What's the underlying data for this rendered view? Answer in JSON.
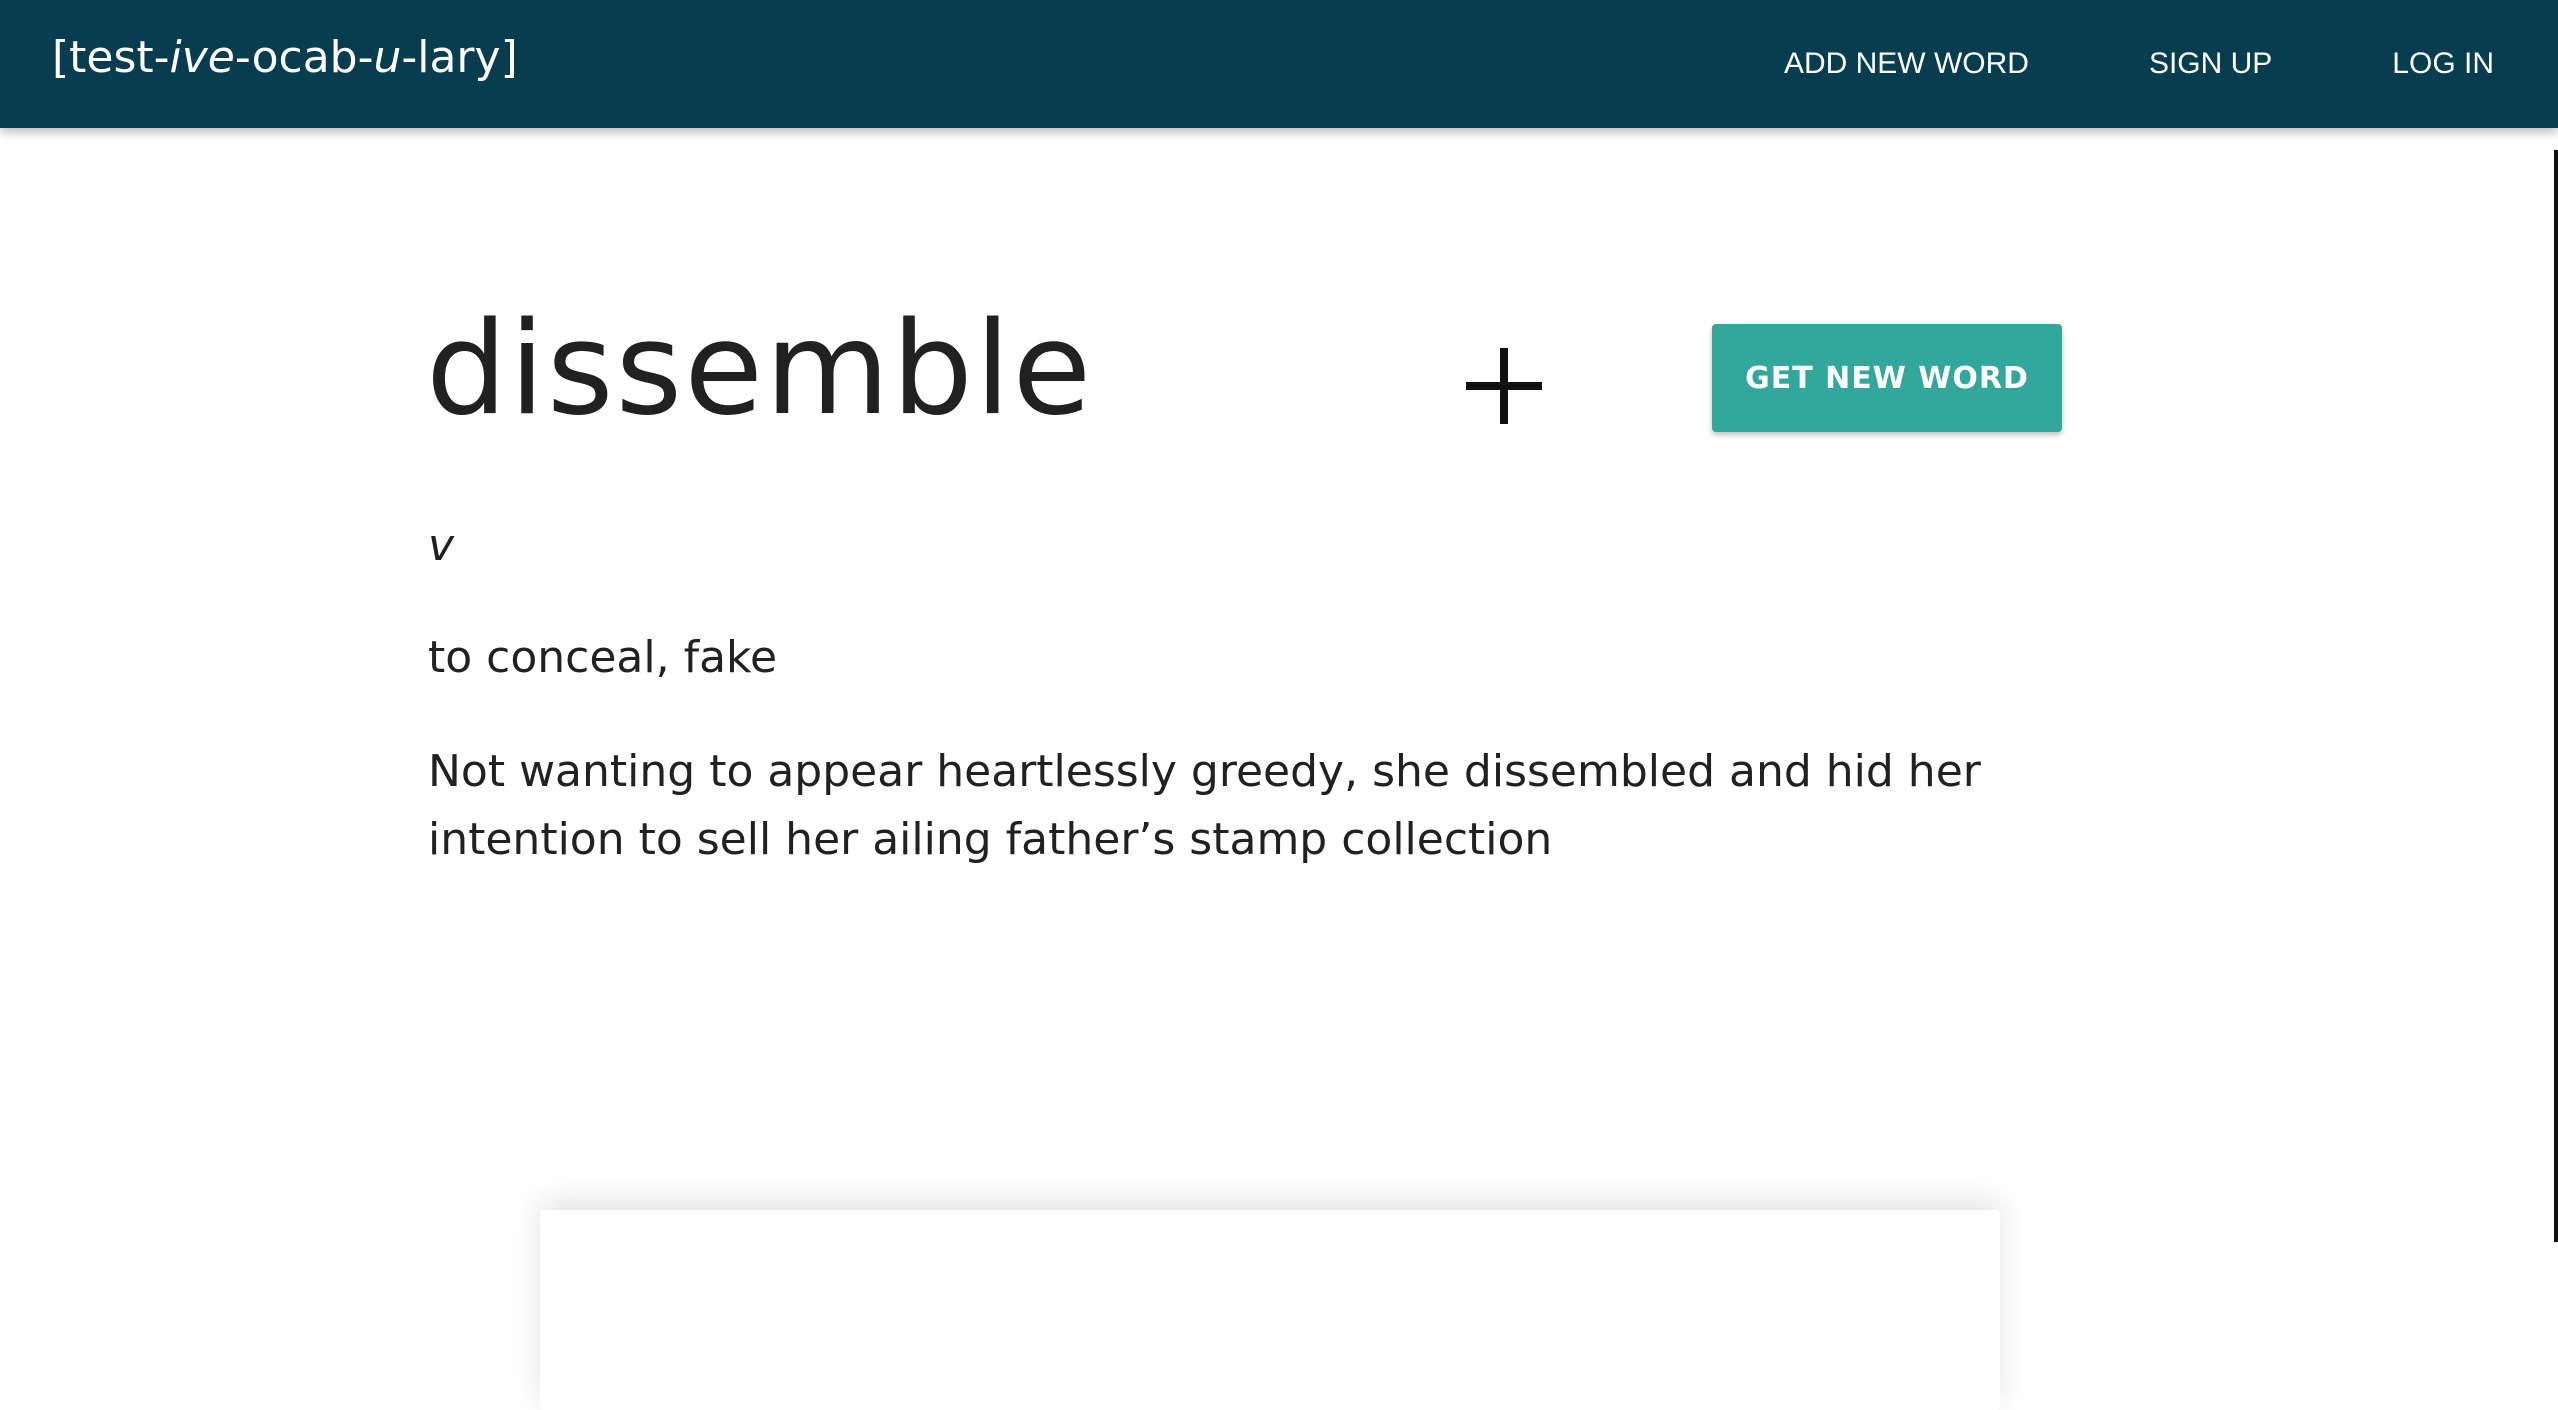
{
  "brand": {
    "open_bracket": "[",
    "part1": "test-",
    "part2": "ive",
    "part3": "-ocab-",
    "part4": "u",
    "part5": "-lary",
    "close_bracket": "]"
  },
  "nav": {
    "add_new_word": "ADD NEW WORD",
    "sign_up": "SIGN UP",
    "log_in": "LOG IN"
  },
  "entry": {
    "word": "dissemble",
    "part_of_speech": "v",
    "definition": "to conceal, fake",
    "example": "Not wanting to appear heartlessly greedy, she dissembled and hid her intention to sell her ailing father’s stamp collection"
  },
  "actions": {
    "get_new_word": "GET NEW WORD",
    "add_icon": "plus-icon"
  },
  "colors": {
    "navbar": "#073d4f",
    "accent": "#32a89c",
    "text": "#212121"
  }
}
